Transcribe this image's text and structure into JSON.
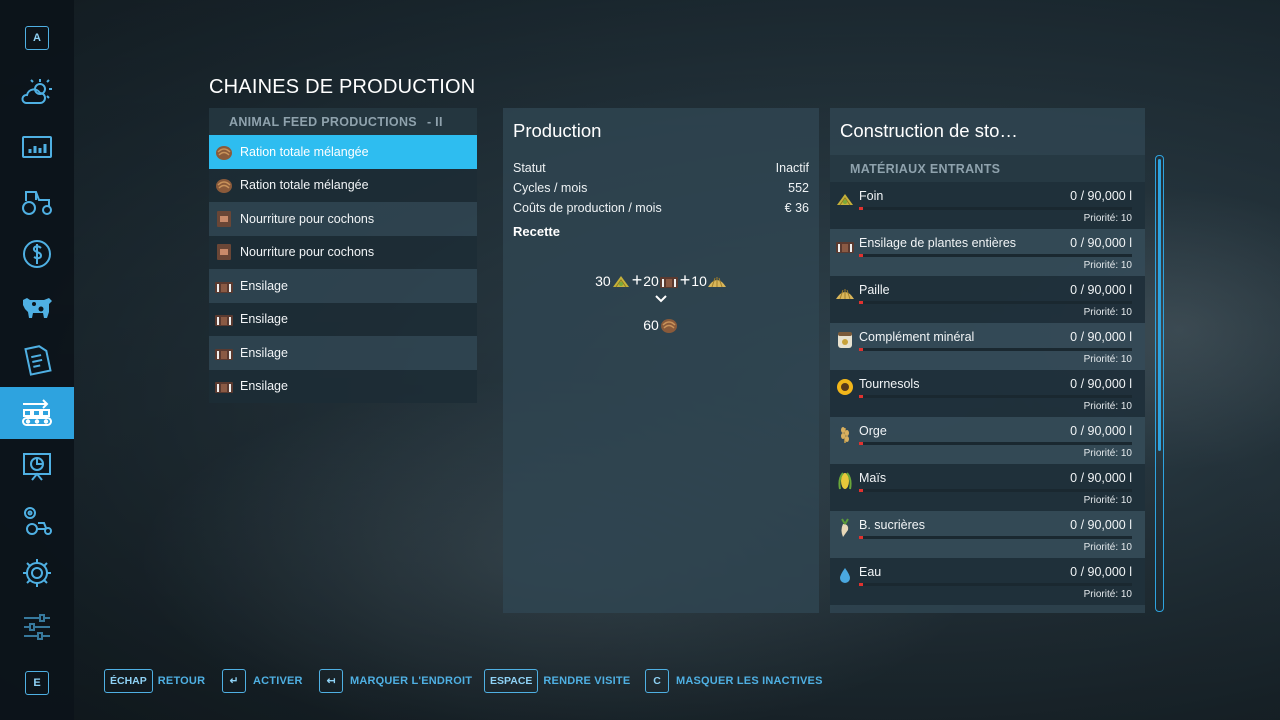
{
  "sidebar": {
    "top_key": "A",
    "bottom_key": "E",
    "items": [
      {
        "name": "weather-icon",
        "active": false
      },
      {
        "name": "statistics-icon",
        "active": false
      },
      {
        "name": "tractor-icon",
        "active": false
      },
      {
        "name": "finance-icon",
        "active": false
      },
      {
        "name": "animals-icon",
        "active": false
      },
      {
        "name": "contracts-icon",
        "active": false
      },
      {
        "name": "production-chains-icon",
        "active": true
      },
      {
        "name": "presentation-icon",
        "active": false
      },
      {
        "name": "vehicle-settings-icon",
        "active": false
      },
      {
        "name": "settings-gear-icon",
        "active": false
      },
      {
        "name": "sliders-icon",
        "active": false
      }
    ]
  },
  "page_title": "CHAINES DE PRODUCTION",
  "production_list": {
    "header": "ANIMAL FEED PRODUCTIONS",
    "header_suffix": "- II",
    "items": [
      {
        "label": "Ration totale mélangée",
        "icon": "tmr-icon",
        "selected": true
      },
      {
        "label": "Ration totale mélangée",
        "icon": "tmr-icon",
        "selected": false
      },
      {
        "label": "Nourriture pour cochons",
        "icon": "pig-food-icon",
        "selected": false
      },
      {
        "label": "Nourriture pour cochons",
        "icon": "pig-food-icon",
        "selected": false
      },
      {
        "label": "Ensilage",
        "icon": "silage-icon",
        "selected": false
      },
      {
        "label": "Ensilage",
        "icon": "silage-icon",
        "selected": false
      },
      {
        "label": "Ensilage",
        "icon": "silage-icon",
        "selected": false
      },
      {
        "label": "Ensilage",
        "icon": "silage-icon",
        "selected": false
      }
    ]
  },
  "production": {
    "title": "Production",
    "stats": [
      {
        "label": "Statut",
        "value": "Inactif"
      },
      {
        "label": "Cycles / mois",
        "value": "552"
      },
      {
        "label": "Coûts de production / mois",
        "value": "€ 36"
      }
    ],
    "recipe_label": "Recette",
    "recipe": {
      "inputs": [
        {
          "amount": "30",
          "icon": "hay-icon"
        },
        {
          "amount": "20",
          "icon": "silage-icon"
        },
        {
          "amount": "10",
          "icon": "straw-icon"
        }
      ],
      "plus": "+",
      "output": {
        "amount": "60",
        "icon": "tmr-icon"
      }
    }
  },
  "storage": {
    "title": "Construction de sto…",
    "subheader": "MATÉRIAUX ENTRANTS",
    "items": [
      {
        "name": "Foin",
        "icon": "hay-icon",
        "amount": "0  / 90,000 l",
        "fill": 0.0,
        "priority": "Priorité: 10"
      },
      {
        "name": "Ensilage de plantes entières",
        "icon": "silage-icon",
        "amount": "0  / 90,000 l",
        "fill": 0.0,
        "priority": "Priorité: 10"
      },
      {
        "name": "Paille",
        "icon": "straw-icon",
        "amount": "0  / 90,000 l",
        "fill": 0.0,
        "priority": "Priorité: 10"
      },
      {
        "name": "Complément minéral",
        "icon": "mineral-icon",
        "amount": "0  / 90,000 l",
        "fill": 0.0,
        "priority": "Priorité: 10"
      },
      {
        "name": "Tournesols",
        "icon": "sunflower-icon",
        "amount": "0  / 90,000 l",
        "fill": 0.0,
        "priority": "Priorité: 10"
      },
      {
        "name": "Orge",
        "icon": "barley-icon",
        "amount": "0  / 90,000 l",
        "fill": 0.0,
        "priority": "Priorité: 10"
      },
      {
        "name": "Maïs",
        "icon": "maize-icon",
        "amount": "0  / 90,000 l",
        "fill": 0.0,
        "priority": "Priorité: 10"
      },
      {
        "name": "B. sucrières",
        "icon": "sugarbeet-icon",
        "amount": "0  / 90,000 l",
        "fill": 0.0,
        "priority": "Priorité: 10"
      },
      {
        "name": "Eau",
        "icon": "water-drop-icon",
        "amount": "0  / 90,000 l",
        "fill": 0.0,
        "priority": "Priorité: 10"
      }
    ]
  },
  "footer": [
    {
      "key": "ÉCHAP",
      "label": "RETOUR"
    },
    {
      "key": "↵",
      "label": "ACTIVER"
    },
    {
      "key": "↤",
      "label": "MARQUER L'ENDROIT"
    },
    {
      "key": "ESPACE",
      "label": "RENDRE VISITE"
    },
    {
      "key": "C",
      "label": "MASQUER LES INACTIVES"
    }
  ],
  "colors": {
    "accent": "#2ea3df",
    "selected_row": "#2ebdf0",
    "fill_bar": "#e0322f"
  }
}
